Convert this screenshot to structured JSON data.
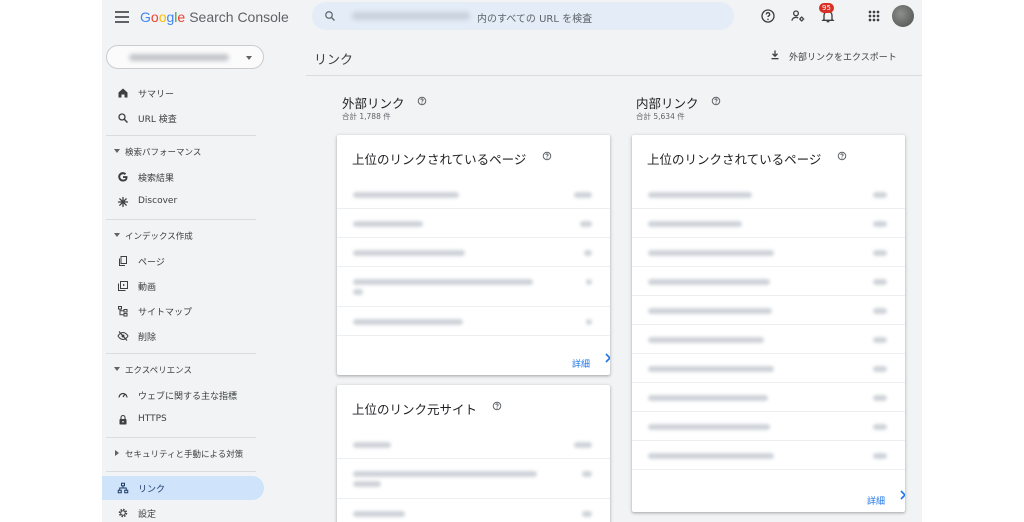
{
  "app": {
    "logo": {
      "g1": "G",
      "g2": "o",
      "g3": "o",
      "g4": "g",
      "g5": "l",
      "g6": "e",
      "product": "Search Console"
    },
    "search": {
      "placeholder_suffix": "内のすべての URL を検査"
    },
    "notifications_count": "95",
    "icons": {
      "help": "help-icon",
      "account": "manage-accounts-icon",
      "notifications": "bell-icon",
      "apps": "apps-grid-icon"
    }
  },
  "sidebar": {
    "items": [
      {
        "label": "サマリー",
        "icon": "home-icon"
      },
      {
        "label": "URL 検査",
        "icon": "search-icon"
      },
      {
        "section": "検索パフォーマンス"
      },
      {
        "label": "検索結果",
        "icon": "google-g-icon"
      },
      {
        "label": "Discover",
        "icon": "asterisk-icon"
      },
      {
        "section": "インデックス作成"
      },
      {
        "label": "ページ",
        "icon": "pages-icon"
      },
      {
        "label": "動画",
        "icon": "video-icon"
      },
      {
        "label": "サイトマップ",
        "icon": "sitemap-icon"
      },
      {
        "label": "削除",
        "icon": "eye-off-icon"
      },
      {
        "section": "エクスペリエンス"
      },
      {
        "label": "ウェブに関する主な指標",
        "icon": "speed-icon"
      },
      {
        "label": "HTTPS",
        "icon": "lock-icon"
      },
      {
        "section": "セキュリティと手動による対策"
      },
      {
        "label": "リンク",
        "icon": "links-icon",
        "active": true
      },
      {
        "label": "設定",
        "icon": "gear-icon"
      }
    ]
  },
  "main": {
    "title": "リンク",
    "export_label": "外部リンクをエクスポート",
    "external": {
      "title": "外部リンク",
      "total": "合計 1,788 件",
      "top_pages": {
        "title": "上位のリンクされているページ",
        "more": "詳細"
      },
      "top_sites": {
        "title": "上位のリンク元サイト"
      }
    },
    "internal": {
      "title": "内部リンク",
      "total": "合計 5,634 件",
      "top_pages": {
        "title": "上位のリンクされているページ",
        "more": "詳細"
      }
    }
  },
  "colors": {
    "accent": "#1a73e8",
    "active_nav": "#cfe3fb",
    "badge": "#d93025"
  }
}
